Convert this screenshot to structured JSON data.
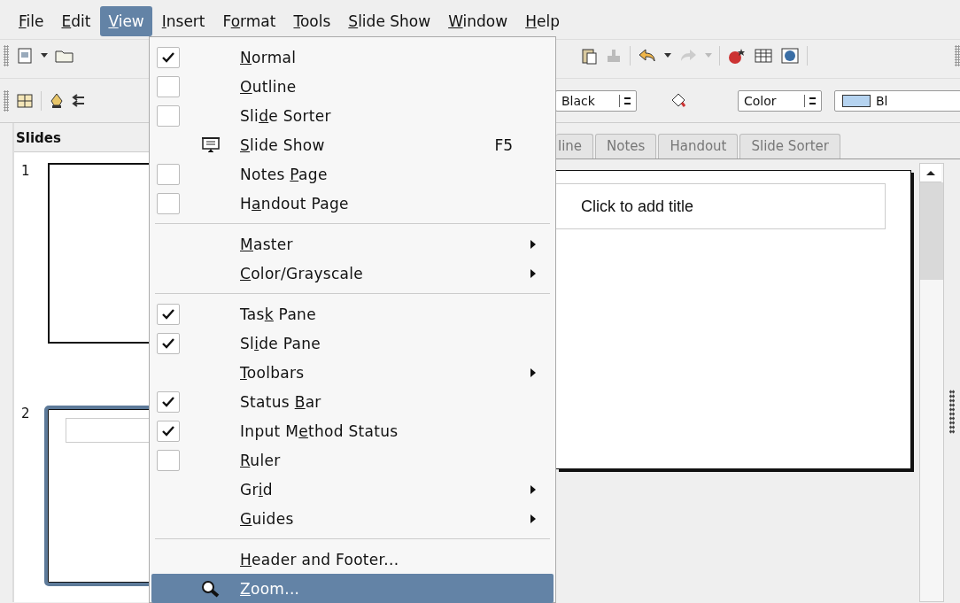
{
  "menubar": [
    {
      "key": "F",
      "after": "ile",
      "selected": false
    },
    {
      "key": "E",
      "after": "dit",
      "selected": false
    },
    {
      "key": "V",
      "after": "iew",
      "selected": true
    },
    {
      "key": "I",
      "after": "nsert",
      "selected": false
    },
    {
      "before": "F",
      "key": "o",
      "after": "rmat",
      "selected": false
    },
    {
      "key": "T",
      "after": "ools",
      "selected": false
    },
    {
      "key": "S",
      "after": "lide Show",
      "selected": false
    },
    {
      "key": "W",
      "after": "indow",
      "selected": false
    },
    {
      "key": "H",
      "after": "elp",
      "selected": false
    }
  ],
  "toolbar": {
    "combos": [
      {
        "value": "Black"
      },
      {
        "value": "Color"
      },
      {
        "value": "Bl"
      }
    ]
  },
  "slides_pane": {
    "title": "Slides",
    "slides": [
      {
        "number": "1",
        "selected": false
      },
      {
        "number": "2",
        "selected": true
      }
    ]
  },
  "view_tabs": [
    {
      "label": "line",
      "selected": false
    },
    {
      "label": "Notes",
      "selected": false
    },
    {
      "label": "Handout",
      "selected": false
    },
    {
      "label": "Slide Sorter",
      "selected": false
    }
  ],
  "slide": {
    "title_placeholder": "Click to add title"
  },
  "view_menu": [
    {
      "kind": "check",
      "checked": true,
      "key": "N",
      "after": "ormal",
      "selected": false
    },
    {
      "kind": "check",
      "checked": false,
      "key": "O",
      "after": "utline",
      "selected": false
    },
    {
      "kind": "check",
      "checked": false,
      "before": "Sli",
      "key": "d",
      "after": "e Sorter",
      "selected": false
    },
    {
      "kind": "screen",
      "key": "S",
      "after": "lide Show",
      "shortcut": "F5",
      "selected": false
    },
    {
      "kind": "check",
      "checked": false,
      "before": "Notes ",
      "key": "P",
      "after": "age",
      "selected": false
    },
    {
      "kind": "check",
      "checked": false,
      "before": "H",
      "key": "a",
      "after": "ndout Page",
      "selected": false
    },
    {
      "kind": "separator"
    },
    {
      "kind": "plain",
      "submenu": true,
      "key": "M",
      "after": "aster",
      "selected": false
    },
    {
      "kind": "plain",
      "submenu": true,
      "key": "C",
      "after": "olor/Grayscale",
      "selected": false
    },
    {
      "kind": "separator"
    },
    {
      "kind": "check",
      "checked": true,
      "before": "Tas",
      "key": "k",
      "after": " Pane",
      "selected": false
    },
    {
      "kind": "check",
      "checked": true,
      "before": "Sl",
      "key": "i",
      "after": "de Pane",
      "selected": false
    },
    {
      "kind": "plain",
      "submenu": true,
      "key": "T",
      "after": "oolbars",
      "selected": false
    },
    {
      "kind": "check",
      "checked": true,
      "before": "Status ",
      "key": "B",
      "after": "ar",
      "selected": false
    },
    {
      "kind": "check",
      "checked": true,
      "before": "Input M",
      "key": "e",
      "after": "thod Status",
      "selected": false
    },
    {
      "kind": "check",
      "checked": false,
      "key": "R",
      "after": "uler",
      "selected": false
    },
    {
      "kind": "plain",
      "submenu": true,
      "before": "Gr",
      "key": "i",
      "after": "d",
      "selected": false
    },
    {
      "kind": "plain",
      "submenu": true,
      "key": "G",
      "after": "uides",
      "selected": false
    },
    {
      "kind": "separator"
    },
    {
      "kind": "plain",
      "key": "H",
      "after": "eader and Footer...",
      "selected": false
    },
    {
      "kind": "magnifier",
      "key": "Z",
      "after": "oom...",
      "selected": true
    }
  ]
}
